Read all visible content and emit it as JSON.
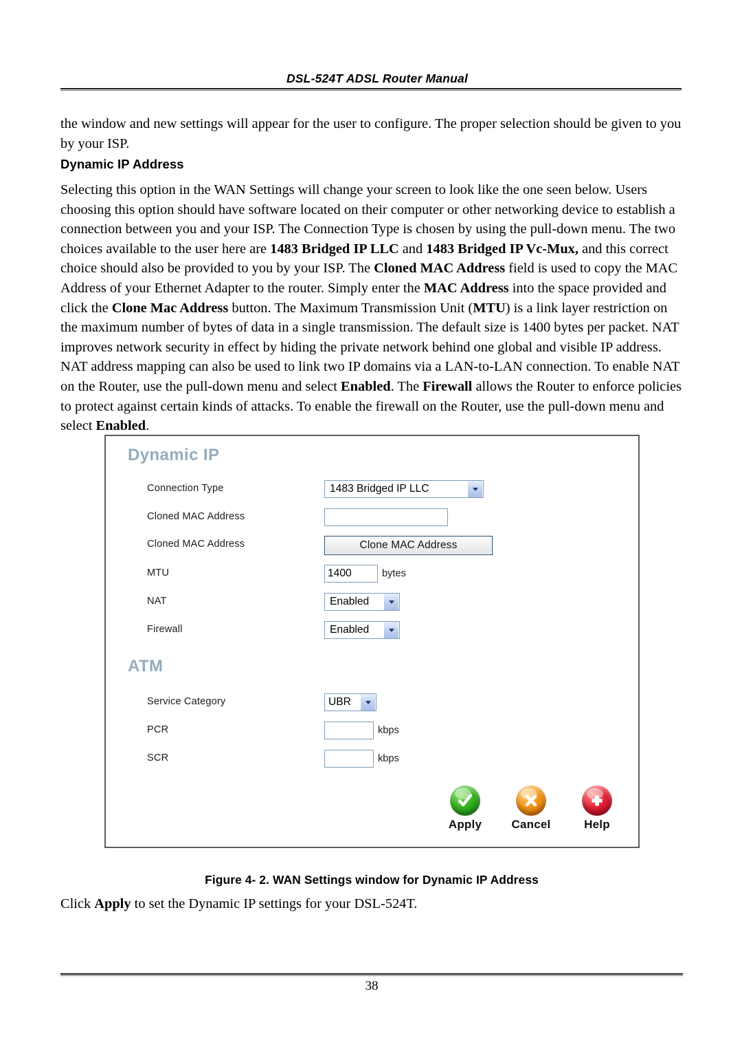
{
  "header": {
    "title": "DSL-524T ADSL Router Manual"
  },
  "intro_paragraph": "the window and new settings will appear for the user to configure. The proper selection should be given to you by your ISP.",
  "section_heading": "Dynamic IP Address",
  "main_paragraph": {
    "t1": "Selecting this option in the WAN Settings will change your screen to look like the one seen below. Users choosing this option should have software located on their computer or other networking device to establish a connection between you and your ISP. The Connection Type is chosen by using the pull-down menu. The two choices available to the user here are ",
    "b1": "1483 Bridged IP LLC",
    "t2": " and ",
    "b2": "1483 Bridged IP Vc-Mux,",
    "t3": " and this correct choice should also be provided to you by your ISP. The ",
    "b3": "Cloned MAC Address",
    "t4": " field is used to copy the MAC Address of your Ethernet Adapter to the router. Simply enter the ",
    "b4": "MAC Address",
    "t5": " into the space provided and click the ",
    "b5": "Clone Mac Address",
    "t6": " button",
    "t6b": ". The Maximum Transmission Unit (",
    "b6": "MTU",
    "t7": ") is a link layer restriction on the maximum number of bytes of data in a single transmission. The default size is 1400 bytes per packet. NAT improves network security in effect by hiding the private network behind one global and visible IP address. NAT address mapping can also be used to link two IP domains via a LAN-to-LAN connection. To enable NAT on the Router, use the pull-down menu and select ",
    "b7": "Enabled",
    "t8": ". The ",
    "b8": "Firewall",
    "t9": " allows the Router to enforce policies to protect against certain kinds of attacks.  To enable the firewall on the Router, use the pull-down menu and select ",
    "b9": "Enabled",
    "t10": "."
  },
  "figure": {
    "group_dynamic_ip": "Dynamic IP",
    "group_atm": "ATM",
    "heading_color": "#93acbd",
    "rows": [
      {
        "label": "Connection Type",
        "value": "1483 Bridged IP LLC",
        "unit": ""
      },
      {
        "label": "Cloned MAC Address",
        "value": "",
        "unit": ""
      },
      {
        "label": "Cloned MAC Address",
        "value": "Clone MAC Address",
        "unit": ""
      },
      {
        "label": "MTU",
        "value": "1400",
        "unit": "bytes"
      },
      {
        "label": "NAT",
        "value": "Enabled",
        "unit": ""
      },
      {
        "label": "Firewall",
        "value": "Enabled",
        "unit": ""
      },
      {
        "label": "Service Category",
        "value": "UBR",
        "unit": ""
      },
      {
        "label": "PCR",
        "value": "",
        "unit": "kbps"
      },
      {
        "label": "SCR",
        "value": "",
        "unit": "kbps"
      }
    ],
    "actions": [
      {
        "label": "Apply",
        "color": "#2e9e1c"
      },
      {
        "label": "Cancel",
        "color": "#ef8f12"
      },
      {
        "label": "Help",
        "color": "#d91f33"
      }
    ]
  },
  "figure_caption": "Figure 4- 2. WAN Settings window for Dynamic IP Address",
  "closing_paragraph": {
    "t1": "Click ",
    "b1": "Apply",
    "t2": " to set the Dynamic IP settings for your DSL-524T."
  },
  "footer": {
    "page_number": "38"
  }
}
